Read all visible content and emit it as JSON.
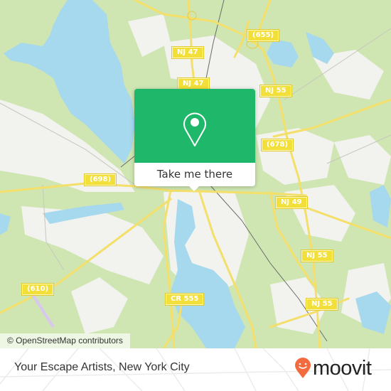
{
  "map": {
    "road_shields": [
      {
        "label": "NJ 47"
      },
      {
        "label": "(655)"
      },
      {
        "label": "NJ 47"
      },
      {
        "label": "NJ 55"
      },
      {
        "label": "(678)"
      },
      {
        "label": "(698)"
      },
      {
        "label": "NJ 49"
      },
      {
        "label": "NJ 55"
      },
      {
        "label": "(610)"
      },
      {
        "label": "CR 555"
      },
      {
        "label": "NJ 55"
      }
    ],
    "attribution": "© OpenStreetMap contributors",
    "colors": {
      "land": "#cfe6b2",
      "urban": "#f2f2ee",
      "water": "#a6d8ee",
      "road": "#f3df6a",
      "rail": "#6b6b6b"
    }
  },
  "popup": {
    "icon": "map-pin-icon",
    "action_label": "Take me there",
    "accent_color": "#1fb86a"
  },
  "footer": {
    "place_name": "Your Escape Artists, New York City",
    "logo_text": "moovit",
    "logo_icon": "moovit-pin-icon",
    "logo_color": "#f26a3d"
  }
}
